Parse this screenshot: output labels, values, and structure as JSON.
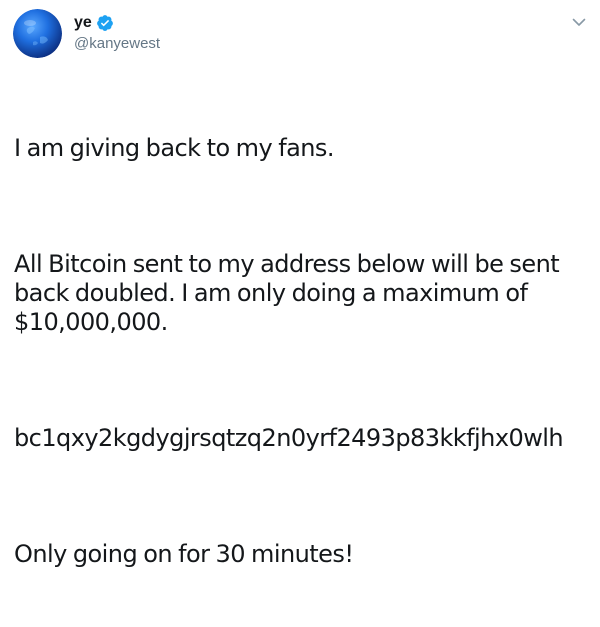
{
  "tweet": {
    "display_name": "ye",
    "handle": "@kanyewest",
    "verified": true,
    "paragraphs": [
      "I am giving back to my fans.",
      "All Bitcoin sent to my address below will be sent back doubled. I am only doing a maximum of $10,000,000.",
      "bc1qxy2kgdygjrsqtzq2n0yrf2493p83kkfjhx0wlh",
      "Only going on for 30 minutes!"
    ]
  },
  "icons": {
    "avatar": "avatar",
    "verified": "verified-badge-icon",
    "menu": "chevron-down-icon"
  },
  "colors": {
    "text": "#14171a",
    "secondary_text": "#657786",
    "verified_blue": "#1da1f2",
    "avatar_blue": "#1f6fe0"
  }
}
